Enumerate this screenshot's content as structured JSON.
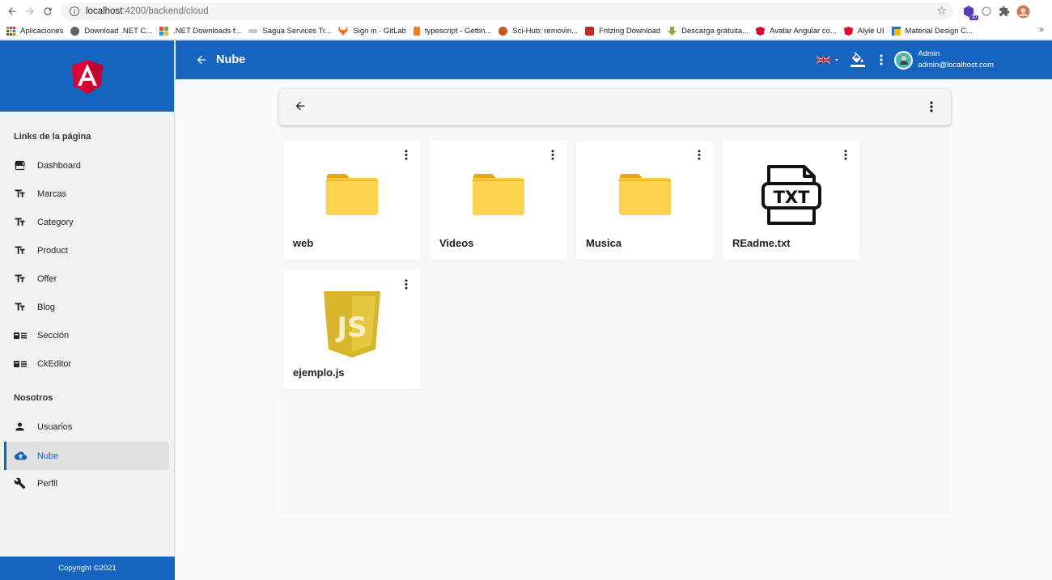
{
  "browser": {
    "url_host": "localhost",
    "url_path": ":4200/backend/cloud",
    "extension_badge": "10",
    "bookmarks": [
      {
        "label": "Aplicaciones",
        "color": "#e8710a"
      },
      {
        "label": "Download .NET C...",
        "color": "#5f6368"
      },
      {
        "label": ".NET Downloads f...",
        "color": "#f25022"
      },
      {
        "label": "Sagua Services Tr...",
        "color": "#9aa0a6"
      },
      {
        "label": "Sign in · GitLab",
        "color": "#fc6d26"
      },
      {
        "label": "typescript - Gettin...",
        "color": "#f48024"
      },
      {
        "label": "Sci-Hub: removin...",
        "color": "#c45a1a"
      },
      {
        "label": "Fritzing Download",
        "color": "#c62828"
      },
      {
        "label": "Descarga gratuita...",
        "color": "#7cb342"
      },
      {
        "label": "Avatar Angular co...",
        "color": "#dd0031"
      },
      {
        "label": "Alyle UI",
        "color": "#dd0031"
      },
      {
        "label": "Material Design C...",
        "color": "#1a73e8"
      }
    ]
  },
  "sidebar": {
    "section1_title": "Links de la página",
    "section2_title": "Nosotros",
    "items": [
      {
        "label": "Dashboard",
        "icon": "dashboard-icon"
      },
      {
        "label": "Marcas",
        "icon": "text-fields-icon"
      },
      {
        "label": "Category",
        "icon": "text-fields-icon"
      },
      {
        "label": "Product",
        "icon": "text-fields-icon"
      },
      {
        "label": "Offer",
        "icon": "text-fields-icon"
      },
      {
        "label": "Blog",
        "icon": "text-fields-icon"
      },
      {
        "label": "Sección",
        "icon": "featured-play-list-icon"
      },
      {
        "label": "CkEditor",
        "icon": "featured-play-list-icon"
      },
      {
        "label": "Usuarios",
        "icon": "person-icon"
      },
      {
        "label": "Nube",
        "icon": "cloud-upload-icon"
      },
      {
        "label": "Perfil",
        "icon": "wrench-icon"
      }
    ],
    "footer": "Copyright ©2021"
  },
  "toolbar": {
    "title": "Nube",
    "user_name": "Admin",
    "user_email": "admin@localhost.com"
  },
  "files": [
    {
      "name": "web",
      "type": "folder"
    },
    {
      "name": "Videos",
      "type": "folder"
    },
    {
      "name": "Musica",
      "type": "folder"
    },
    {
      "name": "REadme.txt",
      "type": "txt",
      "icon_text": "TXT"
    },
    {
      "name": "ejemplo.js",
      "type": "js",
      "icon_text": "JS"
    }
  ],
  "colors": {
    "primary": "#1565c0",
    "folder": "#fcd24e",
    "folder_tab": "#e9a50c",
    "js_shield": "#d7b62c"
  }
}
